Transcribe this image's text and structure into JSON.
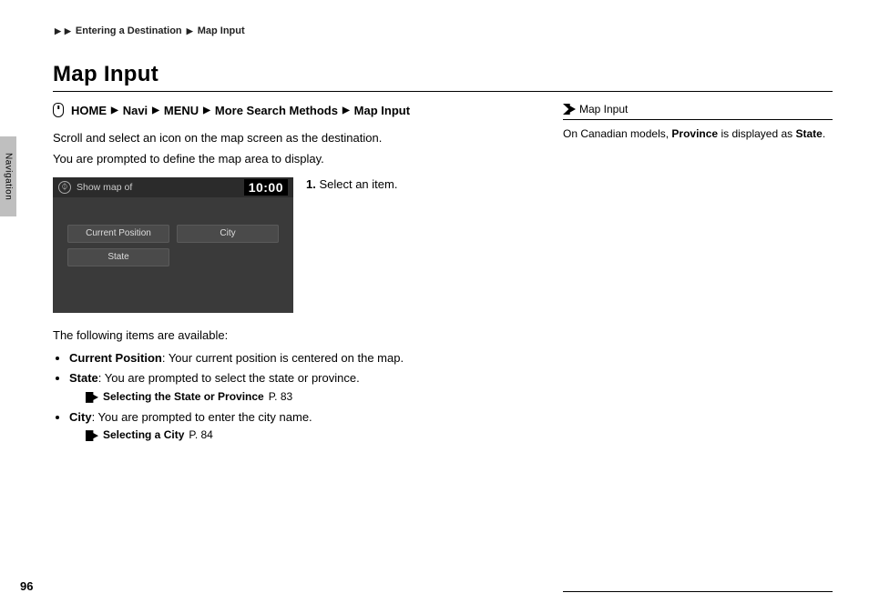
{
  "breadcrumb": {
    "item1": "Entering a Destination",
    "item2": "Map Input"
  },
  "title": "Map Input",
  "nav_path": {
    "p1": "HOME",
    "p2": "Navi",
    "p3": "MENU",
    "p4": "More Search Methods",
    "p5": "Map Input"
  },
  "intro1": "Scroll and select an icon on the map screen as the destination.",
  "intro2": "You are prompted to define the map area to display.",
  "screenshot": {
    "header": "Show map of",
    "clock": "10:00",
    "btn1": "Current Position",
    "btn2": "City",
    "btn3": "State"
  },
  "step1_num": "1.",
  "step1_text": " Select an item.",
  "avail_header": "The following items are available:",
  "items": {
    "current_position": {
      "label": "Current Position",
      "text": ": Your current position is centered on the map."
    },
    "state": {
      "label": "State",
      "text": ": You are prompted to select the state or province.",
      "ref_text": "Selecting the State or Province",
      "ref_page": " P. 83"
    },
    "city": {
      "label": "City",
      "text": ": You are prompted to enter the city name.",
      "ref_text": "Selecting a City",
      "ref_page": " P. 84"
    }
  },
  "side_tab": "Navigation",
  "note": {
    "title": "Map Input",
    "line_pre": "On Canadian models, ",
    "line_b1": "Province",
    "line_mid": " is displayed as ",
    "line_b2": "State",
    "line_post": "."
  },
  "page_number": "96"
}
